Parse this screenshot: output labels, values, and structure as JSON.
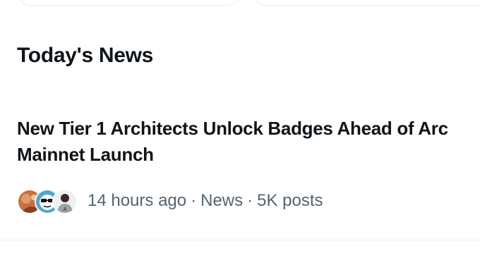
{
  "section": {
    "title": "Today's News"
  },
  "news_item": {
    "headline": "New Tier 1 Architects Unlock Badges Ahead of Arc Mainnet Launch",
    "meta": {
      "time": "14 hours ago",
      "category": "News",
      "posts": "5K posts",
      "separator": "·"
    },
    "avatars": [
      {
        "icon": "avatar-photo-orange"
      },
      {
        "icon": "avatar-cartoon-glasses"
      },
      {
        "icon": "avatar-person-dark"
      }
    ]
  },
  "colors": {
    "text_primary": "#0f1419",
    "text_secondary": "#536471",
    "divider": "#eff3f4"
  }
}
